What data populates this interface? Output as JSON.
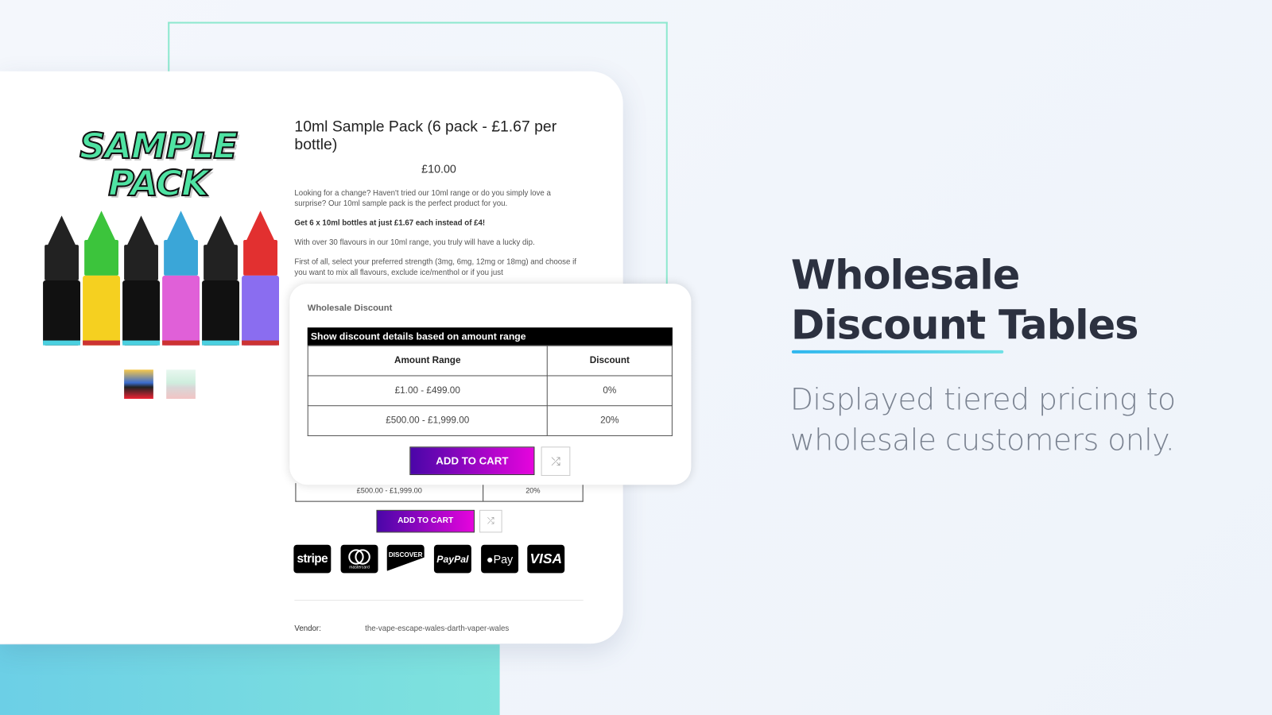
{
  "product": {
    "title": "10ml Sample Pack (6 pack - £1.67 per bottle)",
    "price": "£10.00",
    "description": [
      "Looking for a change? Haven't tried our 10ml range or do you simply love a surprise? Our 10ml sample pack is the perfect product for you.",
      "Get 6 x 10ml bottles at just £1.67 each instead of £4!",
      "With over 30 flavours in our 10ml range, you truly will have a lucky dip.",
      "First of all, select your preferred strength (3mg, 6mg, 12mg or 18mg) and choose if you want to mix all flavours, exclude ice/menthol or if you just"
    ],
    "image_logo_text": "SAMPLE PACK",
    "bottle_colors": [
      "#222222",
      "#3cc43c",
      "#222222",
      "#3aa6d8",
      "#222222",
      "#e23030"
    ],
    "vendor_label": "Vendor:",
    "vendor_value": "the-vape-escape-wales-darth-vaper-wales",
    "background_row": {
      "range": "£500.00 - £1,999.00",
      "discount": "20%"
    },
    "add_to_cart": "ADD TO CART",
    "payment_methods": [
      "stripe",
      "mastercard",
      "DISCOVER",
      "PayPal",
      "Pay",
      "VISA"
    ]
  },
  "popup": {
    "heading": "Wholesale Discount",
    "caption": "Show discount details based on amount range",
    "columns": [
      "Amount Range",
      "Discount"
    ],
    "rows": [
      {
        "range": "£1.00 - £499.00",
        "discount": "0%"
      },
      {
        "range": "£500.00 - £1,999.00",
        "discount": "20%"
      }
    ],
    "add_to_cart": "ADD TO CART"
  },
  "marketing": {
    "headline_line1": "Wholesale",
    "headline_line2": "Discount Tables",
    "subtext_line1": "Displayed tiered pricing to",
    "subtext_line2": "wholesale customers only.",
    "accent_color": "#2fb7ee"
  }
}
